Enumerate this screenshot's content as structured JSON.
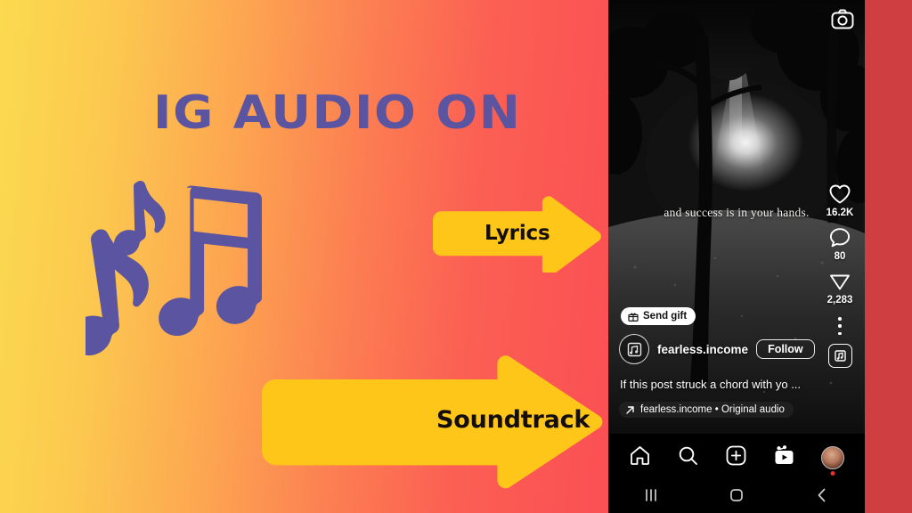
{
  "slide": {
    "headline": "IG AUDIO ON",
    "background": {
      "gradient_start": "#FBDA4F",
      "gradient_end": "#FB4F54",
      "right_strip": "#CF3E40"
    },
    "accent_purple": "#5B54A0",
    "arrow_color": "#FFC61A",
    "arrow_text_color": "#140F0C"
  },
  "graphics": {
    "music_notes_icon": "music-notes-icon"
  },
  "annotations": [
    {
      "id": "lyrics",
      "label": "Lyrics",
      "icon": "right-arrow-icon"
    },
    {
      "id": "soundtrack",
      "label": "Soundtrack",
      "icon": "right-arrow-icon"
    }
  ],
  "phone": {
    "top_bar": {
      "camera_icon": "camera-icon"
    },
    "reel": {
      "overlay_quote": "and success is in your hands.",
      "send_gift": {
        "label": "Send gift",
        "icon": "gift-icon"
      },
      "username": "fearless.income",
      "follow_label": "Follow",
      "caption": "If this post struck a chord with yo ...",
      "audio_attribution": "fearless.income • Original audio",
      "audio_arrow_icon": "diagonal-arrow-icon",
      "audio_thumb_icon": "audio-cover-icon"
    },
    "actions": [
      {
        "id": "like",
        "icon": "heart-icon",
        "count": "16.2K"
      },
      {
        "id": "comment",
        "icon": "comment-icon",
        "count": "80"
      },
      {
        "id": "share",
        "icon": "send-icon",
        "count": "2,283"
      },
      {
        "id": "more",
        "icon": "more-dots-icon",
        "count": ""
      }
    ],
    "bottom_nav": [
      {
        "id": "home",
        "icon": "home-icon"
      },
      {
        "id": "search",
        "icon": "search-icon"
      },
      {
        "id": "create",
        "icon": "plus-square-icon"
      },
      {
        "id": "reels",
        "icon": "reels-icon"
      },
      {
        "id": "profile",
        "icon": "profile-avatar-icon"
      }
    ],
    "system_nav": [
      {
        "id": "recents",
        "icon": "recents-icon"
      },
      {
        "id": "home",
        "icon": "home-square-icon"
      },
      {
        "id": "back",
        "icon": "back-chevron-icon"
      }
    ]
  }
}
